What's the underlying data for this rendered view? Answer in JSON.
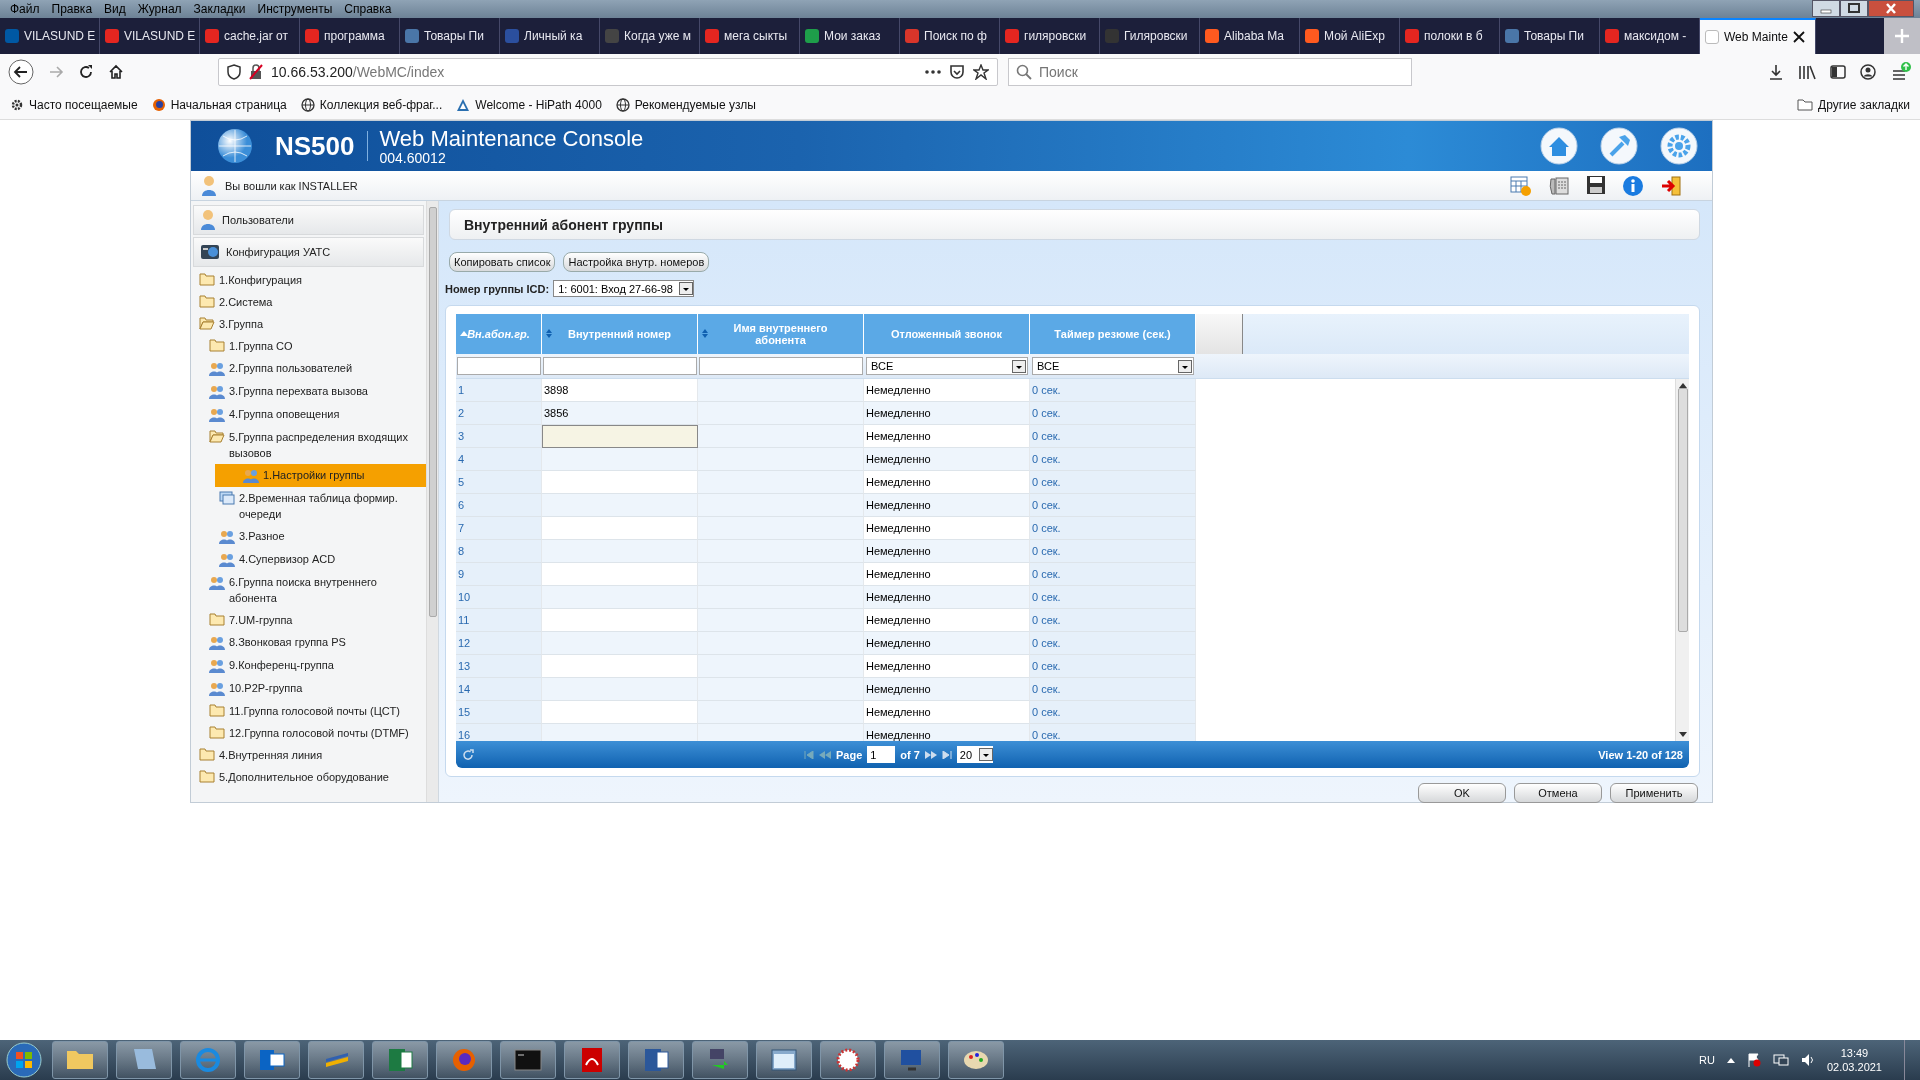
{
  "window": {
    "menu": [
      "Файл",
      "Правка",
      "Вид",
      "Журнал",
      "Закладки",
      "Инструменты",
      "Справка"
    ]
  },
  "tabs": [
    {
      "label": "VILASUND E",
      "selected": false,
      "color": "#0058a3"
    },
    {
      "label": "VILASUND E",
      "selected": false,
      "color": "#e52620"
    },
    {
      "label": "cache.jar от",
      "selected": false,
      "color": "#e52620"
    },
    {
      "label": "программа",
      "selected": false,
      "color": "#e52620"
    },
    {
      "label": "Товары Пи",
      "selected": false,
      "color": "#4a76a8"
    },
    {
      "label": "Личный ка",
      "selected": false,
      "color": "#2b4f9e"
    },
    {
      "label": "Когда уже м",
      "selected": false,
      "color": "#444444"
    },
    {
      "label": "мега сыкты",
      "selected": false,
      "color": "#e52620"
    },
    {
      "label": "Мои заказ",
      "selected": false,
      "color": "#1e9e4a"
    },
    {
      "label": "Поиск по ф",
      "selected": false,
      "color": "#d9352a"
    },
    {
      "label": "гиляровски",
      "selected": false,
      "color": "#e52620"
    },
    {
      "label": "Гиляровски",
      "selected": false,
      "color": "#333333"
    },
    {
      "label": "Alibaba Ma",
      "selected": false,
      "color": "#ff5a1f"
    },
    {
      "label": "Мой AliExp",
      "selected": false,
      "color": "#ff5a1f"
    },
    {
      "label": "полоки в б",
      "selected": false,
      "color": "#e52620"
    },
    {
      "label": "Товары Пи",
      "selected": false,
      "color": "#4a76a8"
    },
    {
      "label": "максидом -",
      "selected": false,
      "color": "#e52620"
    },
    {
      "label": "Web Mainte",
      "selected": true,
      "color": "#ffffff"
    }
  ],
  "address_bar": {
    "host": "10.66.53.200",
    "path": "/WebMC/index"
  },
  "search": {
    "placeholder": "Поиск"
  },
  "bookmarks": [
    {
      "label": "Часто посещаемые",
      "kind": "gear"
    },
    {
      "label": "Начальная страница",
      "kind": "browser"
    },
    {
      "label": "Коллекция веб-фраг...",
      "kind": "globe"
    },
    {
      "label": "Welcome - HiPath 4000",
      "kind": "triangle"
    },
    {
      "label": "Рекомендуемые узлы",
      "kind": "globe"
    }
  ],
  "other_bookmarks": "Другие закладки",
  "app": {
    "product": "NS500",
    "title": "Web Maintenance Console",
    "version": "004.60012",
    "login": "Вы вошли как INSTALLER"
  },
  "sidebar": {
    "sections": [
      {
        "label": "Пользователи",
        "kind": "user"
      },
      {
        "label": "Конфигурация УАТС",
        "kind": "pbx"
      }
    ],
    "tree": [
      {
        "label": "1.Конфигурация",
        "kind": "folder",
        "expanded": false,
        "selected": false
      },
      {
        "label": "2.Система",
        "kind": "folder",
        "expanded": false,
        "selected": false
      },
      {
        "label": "3.Группа",
        "kind": "folder",
        "expanded": true,
        "selected": false,
        "children": [
          {
            "label": "1.Группа CO",
            "kind": "folder",
            "expanded": false,
            "selected": false
          },
          {
            "label": "2.Группа пользователей",
            "kind": "group",
            "selected": false
          },
          {
            "label": "3.Группа перехвата вызова",
            "kind": "group",
            "selected": false
          },
          {
            "label": "4.Группа оповещения",
            "kind": "group",
            "selected": false
          },
          {
            "label": "5.Группа распределения входящих вызовов",
            "kind": "folder",
            "expanded": true,
            "selected": false,
            "children": [
              {
                "label": "1.Настройки группы",
                "kind": "group",
                "selected": true
              },
              {
                "label": "2.Временная таблица формир. очереди",
                "kind": "table",
                "selected": false
              },
              {
                "label": "3.Разное",
                "kind": "group",
                "selected": false
              },
              {
                "label": "4.Супервизор ACD",
                "kind": "group",
                "selected": false
              }
            ]
          },
          {
            "label": "6.Группа поиска внутреннего абонента",
            "kind": "group",
            "selected": false
          },
          {
            "label": "7.UM-группа",
            "kind": "folder",
            "expanded": false,
            "selected": false
          },
          {
            "label": "8.Звонковая группа PS",
            "kind": "group",
            "selected": false
          },
          {
            "label": "9.Конференц-группа",
            "kind": "group",
            "selected": false
          },
          {
            "label": "10.P2P-группа",
            "kind": "group",
            "selected": false
          },
          {
            "label": "11.Группа голосовой почты (ЦСТ)",
            "kind": "folder",
            "expanded": false,
            "selected": false
          },
          {
            "label": "12.Группа голосовой почты (DTMF)",
            "kind": "folder",
            "expanded": false,
            "selected": false
          }
        ]
      },
      {
        "label": "4.Внутренняя линия",
        "kind": "folder",
        "expanded": false,
        "selected": false
      },
      {
        "label": "5.Дополнительное оборудование",
        "kind": "folder",
        "expanded": false,
        "selected": false
      }
    ]
  },
  "page": {
    "title": "Внутренний абонент группы",
    "buttons": [
      "Копировать список",
      "Настройка внутр. номеров"
    ],
    "icd_label": "Номер группы ICD:",
    "icd_value": "1: 6001: Вход 27-66-98"
  },
  "table": {
    "columns": [
      {
        "label": "Вн.абон.гр.",
        "kind": "sortable",
        "sorted": true
      },
      {
        "label": "Внутренний номер",
        "kind": "sortable",
        "sorted": false
      },
      {
        "label": "Имя внутреннего абонента",
        "kind": "sortable",
        "sorted": false
      },
      {
        "label": "Отложенный звонок",
        "kind": "plain",
        "sorted": false
      },
      {
        "label": "Таймер резюме (сек.)",
        "kind": "plain",
        "sorted": false
      }
    ],
    "filters": [
      {
        "kind": "text"
      },
      {
        "kind": "text"
      },
      {
        "kind": "text"
      },
      {
        "kind": "select",
        "value": "ВСЕ"
      },
      {
        "kind": "select",
        "value": "ВСЕ"
      }
    ],
    "rows": [
      {
        "index": "1",
        "extension": "3898",
        "delay": "Немедленно",
        "timer": "0 сек.",
        "editing": false
      },
      {
        "index": "2",
        "extension": "3856",
        "delay": "Немедленно",
        "timer": "0 сек.",
        "editing": false
      },
      {
        "index": "3",
        "delay": "Немедленно",
        "timer": "0 сек.",
        "editing": true
      },
      {
        "index": "4",
        "delay": "Немедленно",
        "timer": "0 сек.",
        "editing": false
      },
      {
        "index": "5",
        "delay": "Немедленно",
        "timer": "0 сек.",
        "editing": false
      },
      {
        "index": "6",
        "delay": "Немедленно",
        "timer": "0 сек.",
        "editing": false
      },
      {
        "index": "7",
        "delay": "Немедленно",
        "timer": "0 сек.",
        "editing": false
      },
      {
        "index": "8",
        "delay": "Немедленно",
        "timer": "0 сек.",
        "editing": false
      },
      {
        "index": "9",
        "delay": "Немедленно",
        "timer": "0 сек.",
        "editing": false
      },
      {
        "index": "10",
        "delay": "Немедленно",
        "timer": "0 сек.",
        "editing": false
      },
      {
        "index": "11",
        "delay": "Немедленно",
        "timer": "0 сек.",
        "editing": false
      },
      {
        "index": "12",
        "delay": "Немедленно",
        "timer": "0 сек.",
        "editing": false
      },
      {
        "index": "13",
        "delay": "Немедленно",
        "timer": "0 сек.",
        "editing": false
      },
      {
        "index": "14",
        "delay": "Немедленно",
        "timer": "0 сек.",
        "editing": false
      },
      {
        "index": "15",
        "delay": "Немедленно",
        "timer": "0 сек.",
        "editing": false
      },
      {
        "index": "16",
        "delay": "Немедленно",
        "timer": "0 сек.",
        "editing": false
      }
    ],
    "pager": {
      "page_label": "Page",
      "page": "1",
      "of": "of 7",
      "per_page": "20",
      "summary": "View 1-20 of 128"
    }
  },
  "actions": [
    "OK",
    "Отмена",
    "Применить"
  ],
  "taskbar": {
    "language": "RU",
    "time": "13:49",
    "date": "02.03.2021"
  }
}
